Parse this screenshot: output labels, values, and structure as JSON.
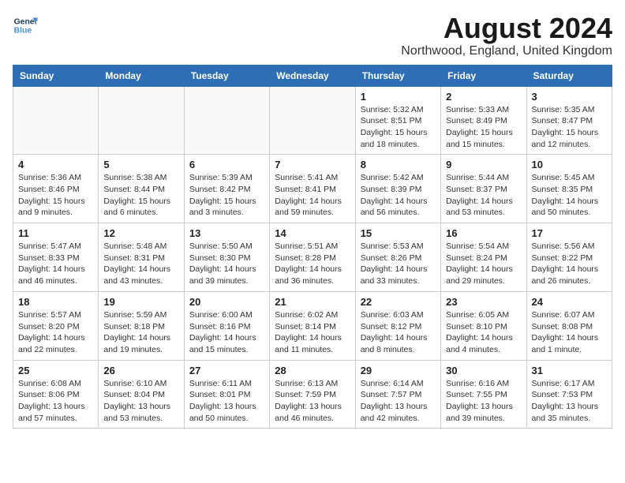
{
  "logo": {
    "line1": "General",
    "line2": "Blue"
  },
  "title": "August 2024",
  "location": "Northwood, England, United Kingdom",
  "days_of_week": [
    "Sunday",
    "Monday",
    "Tuesday",
    "Wednesday",
    "Thursday",
    "Friday",
    "Saturday"
  ],
  "weeks": [
    [
      {
        "day": "",
        "info": ""
      },
      {
        "day": "",
        "info": ""
      },
      {
        "day": "",
        "info": ""
      },
      {
        "day": "",
        "info": ""
      },
      {
        "day": "1",
        "info": "Sunrise: 5:32 AM\nSunset: 8:51 PM\nDaylight: 15 hours\nand 18 minutes."
      },
      {
        "day": "2",
        "info": "Sunrise: 5:33 AM\nSunset: 8:49 PM\nDaylight: 15 hours\nand 15 minutes."
      },
      {
        "day": "3",
        "info": "Sunrise: 5:35 AM\nSunset: 8:47 PM\nDaylight: 15 hours\nand 12 minutes."
      }
    ],
    [
      {
        "day": "4",
        "info": "Sunrise: 5:36 AM\nSunset: 8:46 PM\nDaylight: 15 hours\nand 9 minutes."
      },
      {
        "day": "5",
        "info": "Sunrise: 5:38 AM\nSunset: 8:44 PM\nDaylight: 15 hours\nand 6 minutes."
      },
      {
        "day": "6",
        "info": "Sunrise: 5:39 AM\nSunset: 8:42 PM\nDaylight: 15 hours\nand 3 minutes."
      },
      {
        "day": "7",
        "info": "Sunrise: 5:41 AM\nSunset: 8:41 PM\nDaylight: 14 hours\nand 59 minutes."
      },
      {
        "day": "8",
        "info": "Sunrise: 5:42 AM\nSunset: 8:39 PM\nDaylight: 14 hours\nand 56 minutes."
      },
      {
        "day": "9",
        "info": "Sunrise: 5:44 AM\nSunset: 8:37 PM\nDaylight: 14 hours\nand 53 minutes."
      },
      {
        "day": "10",
        "info": "Sunrise: 5:45 AM\nSunset: 8:35 PM\nDaylight: 14 hours\nand 50 minutes."
      }
    ],
    [
      {
        "day": "11",
        "info": "Sunrise: 5:47 AM\nSunset: 8:33 PM\nDaylight: 14 hours\nand 46 minutes."
      },
      {
        "day": "12",
        "info": "Sunrise: 5:48 AM\nSunset: 8:31 PM\nDaylight: 14 hours\nand 43 minutes."
      },
      {
        "day": "13",
        "info": "Sunrise: 5:50 AM\nSunset: 8:30 PM\nDaylight: 14 hours\nand 39 minutes."
      },
      {
        "day": "14",
        "info": "Sunrise: 5:51 AM\nSunset: 8:28 PM\nDaylight: 14 hours\nand 36 minutes."
      },
      {
        "day": "15",
        "info": "Sunrise: 5:53 AM\nSunset: 8:26 PM\nDaylight: 14 hours\nand 33 minutes."
      },
      {
        "day": "16",
        "info": "Sunrise: 5:54 AM\nSunset: 8:24 PM\nDaylight: 14 hours\nand 29 minutes."
      },
      {
        "day": "17",
        "info": "Sunrise: 5:56 AM\nSunset: 8:22 PM\nDaylight: 14 hours\nand 26 minutes."
      }
    ],
    [
      {
        "day": "18",
        "info": "Sunrise: 5:57 AM\nSunset: 8:20 PM\nDaylight: 14 hours\nand 22 minutes."
      },
      {
        "day": "19",
        "info": "Sunrise: 5:59 AM\nSunset: 8:18 PM\nDaylight: 14 hours\nand 19 minutes."
      },
      {
        "day": "20",
        "info": "Sunrise: 6:00 AM\nSunset: 8:16 PM\nDaylight: 14 hours\nand 15 minutes."
      },
      {
        "day": "21",
        "info": "Sunrise: 6:02 AM\nSunset: 8:14 PM\nDaylight: 14 hours\nand 11 minutes."
      },
      {
        "day": "22",
        "info": "Sunrise: 6:03 AM\nSunset: 8:12 PM\nDaylight: 14 hours\nand 8 minutes."
      },
      {
        "day": "23",
        "info": "Sunrise: 6:05 AM\nSunset: 8:10 PM\nDaylight: 14 hours\nand 4 minutes."
      },
      {
        "day": "24",
        "info": "Sunrise: 6:07 AM\nSunset: 8:08 PM\nDaylight: 14 hours\nand 1 minute."
      }
    ],
    [
      {
        "day": "25",
        "info": "Sunrise: 6:08 AM\nSunset: 8:06 PM\nDaylight: 13 hours\nand 57 minutes."
      },
      {
        "day": "26",
        "info": "Sunrise: 6:10 AM\nSunset: 8:04 PM\nDaylight: 13 hours\nand 53 minutes."
      },
      {
        "day": "27",
        "info": "Sunrise: 6:11 AM\nSunset: 8:01 PM\nDaylight: 13 hours\nand 50 minutes."
      },
      {
        "day": "28",
        "info": "Sunrise: 6:13 AM\nSunset: 7:59 PM\nDaylight: 13 hours\nand 46 minutes."
      },
      {
        "day": "29",
        "info": "Sunrise: 6:14 AM\nSunset: 7:57 PM\nDaylight: 13 hours\nand 42 minutes."
      },
      {
        "day": "30",
        "info": "Sunrise: 6:16 AM\nSunset: 7:55 PM\nDaylight: 13 hours\nand 39 minutes."
      },
      {
        "day": "31",
        "info": "Sunrise: 6:17 AM\nSunset: 7:53 PM\nDaylight: 13 hours\nand 35 minutes."
      }
    ]
  ]
}
